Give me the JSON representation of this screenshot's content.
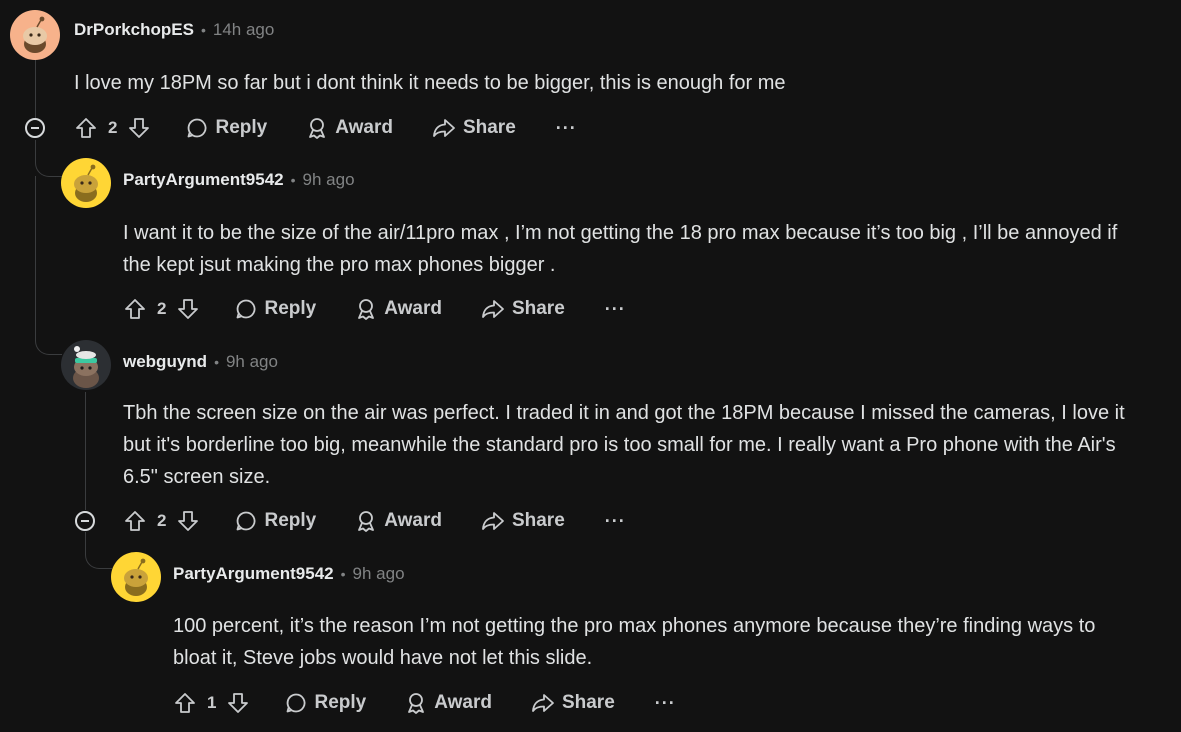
{
  "comments": [
    {
      "username": "DrPorkchopES",
      "separator": "•",
      "time": "14h ago",
      "text": "I love my 18PM so far but i dont think it needs to be bigger, this is enough for me",
      "votes": "2",
      "reply": "Reply",
      "award": "Award",
      "share": "Share",
      "more": "···",
      "avatar_color": "#f7b28b"
    },
    {
      "username": "PartyArgument9542",
      "separator": "•",
      "time": "9h ago",
      "text": "I want it to be the size of the air/11pro max , I’m not getting the 18 pro max because it’s too big , I’ll be annoyed if the kept jsut making the pro max phones bigger .",
      "votes": "2",
      "reply": "Reply",
      "award": "Award",
      "share": "Share",
      "more": "···",
      "avatar_color": "#ffd635"
    },
    {
      "username": "webguynd",
      "separator": "•",
      "time": "9h ago",
      "text": "Tbh the screen size on the air was perfect. I traded it in and got the 18PM because I missed the cameras, I love it but it's borderline too big, meanwhile the standard pro is too small for me. I really want a Pro phone with the Air's 6.5\" screen size.",
      "votes": "2",
      "reply": "Reply",
      "award": "Award",
      "share": "Share",
      "more": "···",
      "avatar_color": "#2c2f33"
    },
    {
      "username": "PartyArgument9542",
      "separator": "•",
      "time": "9h ago",
      "text": "100 percent, it’s the reason I’m not getting the pro max phones anymore because they’re finding ways to bloat it, Steve jobs would have not let this slide.",
      "votes": "1",
      "reply": "Reply",
      "award": "Award",
      "share": "Share",
      "more": "···",
      "avatar_color": "#ffd635"
    }
  ],
  "colors": {
    "background": "#121212",
    "text": "#e0e2e3",
    "meta": "#818384",
    "thread_line": "#3a3c3e"
  },
  "icons": [
    "snoo-avatar-icon",
    "collapse-icon",
    "upvote-icon",
    "downvote-icon",
    "reply-icon",
    "award-icon",
    "share-icon",
    "more-icon"
  ]
}
